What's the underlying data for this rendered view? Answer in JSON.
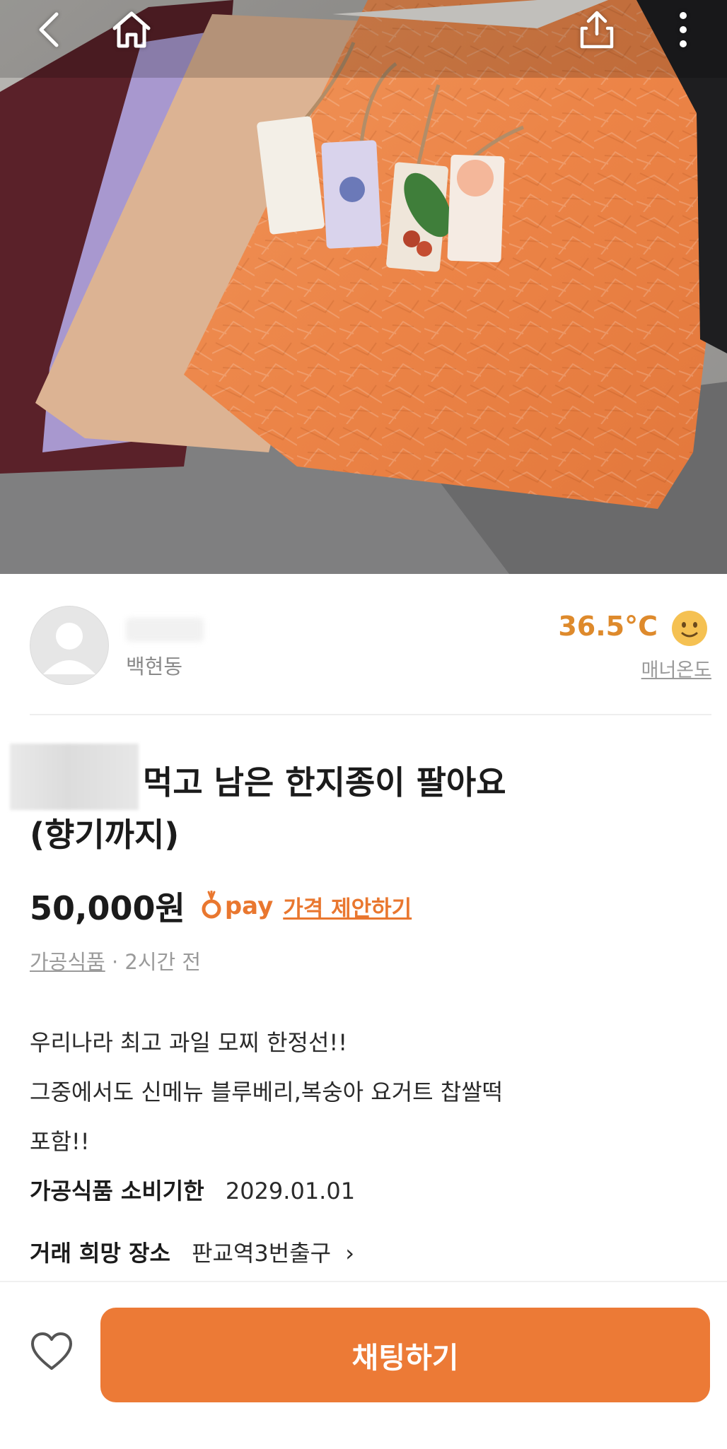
{
  "header": {
    "back_icon": "chevron-left-icon",
    "home_icon": "home-icon",
    "share_icon": "share-icon",
    "more_icon": "more-vertical-icon"
  },
  "seller": {
    "location": "백현동",
    "temperature": "36.5°C",
    "temperature_label": "매너온도",
    "accent_color": "#de8a2c"
  },
  "post": {
    "title_line1": "먹고 남은 한지종이 팔아요",
    "title_line2": "(향기까지)",
    "price": "50,000원",
    "pay_label": "pay",
    "offer_label": "가격 제안하기",
    "category": "가공식품",
    "time_ago": "· 2시간 전",
    "description": [
      "우리나라 최고 과일 모찌 한정선!!",
      "그중에서도 신메뉴 블루베리,복숭아 요거트 찹쌀떡",
      "포함!!"
    ],
    "expiry_label": "가공식품 소비기한",
    "expiry_value": "2029.01.01",
    "place_label": "거래 희망 장소",
    "place_value": "판교역3번출구",
    "place_arrow": "›"
  },
  "bottom_bar": {
    "chat_label": "채팅하기",
    "brand_color": "#ec7a36"
  }
}
